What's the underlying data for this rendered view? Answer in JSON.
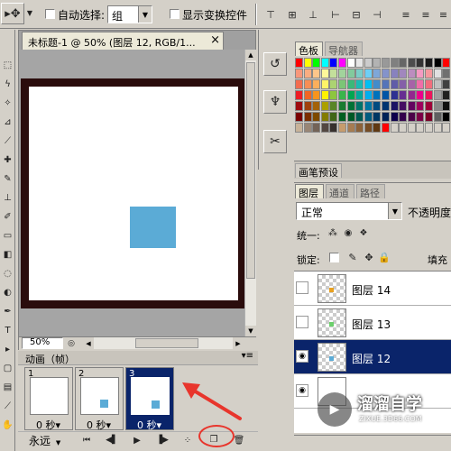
{
  "options_bar": {
    "auto_select_label": "自动选择:",
    "auto_select_value": "组",
    "show_transform_label": "显示变换控件"
  },
  "document": {
    "title": "未标题-1 @ 50% (图层 12, RGB/1...",
    "close_glyph": "×",
    "zoom": "50%",
    "canvas_bg": "#ffffff",
    "frame_color": "#2a0c0c",
    "square_color": "#5babd6"
  },
  "swatches_panel": {
    "tabs": [
      "色板",
      "导航器"
    ]
  },
  "brush_panel": {
    "tab": "画笔预设"
  },
  "layers_panel": {
    "tabs": [
      "图层",
      "通道",
      "路径"
    ],
    "blend_mode": "正常",
    "opacity_label": "不透明度",
    "unify_label": "统一:",
    "lock_label": "锁定:",
    "fill_label": "填充",
    "layers": [
      {
        "name": "图层 14",
        "dot": "#e8a020",
        "selected": false,
        "visible": false
      },
      {
        "name": "图层 13",
        "dot": "#6cd06c",
        "selected": false,
        "visible": false
      },
      {
        "name": "图层 12",
        "dot": "#5babd6",
        "selected": true,
        "visible": true
      },
      {
        "name": "",
        "dot": null,
        "selected": false,
        "visible": true
      }
    ]
  },
  "animation_panel": {
    "title": "动画（帧）",
    "loop": "永远",
    "frames": [
      {
        "number": "1",
        "delay": "0 秒▾",
        "selected": false,
        "has_square": false
      },
      {
        "number": "2",
        "delay": "0 秒▾",
        "selected": false,
        "has_square": true
      },
      {
        "number": "3",
        "delay": "0 秒▾",
        "selected": true,
        "has_square": true
      }
    ]
  },
  "watermark": {
    "name": "溜溜自学",
    "url": "ZIXUE.3D66.COM"
  },
  "colors": {
    "selection": "#0a246a",
    "annotation": "#e8352c"
  }
}
